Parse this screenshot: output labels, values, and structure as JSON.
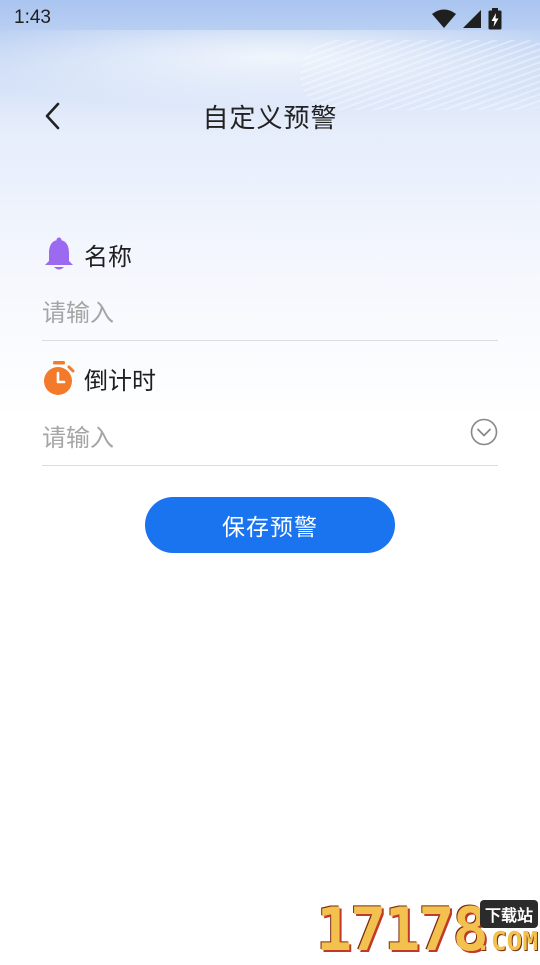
{
  "status_bar": {
    "time": "1:43",
    "icons": [
      "wifi-icon",
      "signal-icon",
      "battery-charging-icon"
    ]
  },
  "header": {
    "title": "自定义预警",
    "back_icon": "chevron-left-icon"
  },
  "form": {
    "name_field": {
      "label": "名称",
      "icon": "bell-icon",
      "icon_color": "#9b6af0",
      "placeholder": "请输入",
      "value": ""
    },
    "countdown_field": {
      "label": "倒计时",
      "icon": "stopwatch-icon",
      "icon_color": "#f47a2b",
      "placeholder": "请输入",
      "value": "",
      "dropdown_icon": "chevron-down-circle-icon"
    },
    "save_button": {
      "label": "保存预警",
      "color": "#1a74f0"
    }
  },
  "watermark": {
    "digits": "17178",
    "tag": "下载站",
    "suffix": ".COM"
  }
}
